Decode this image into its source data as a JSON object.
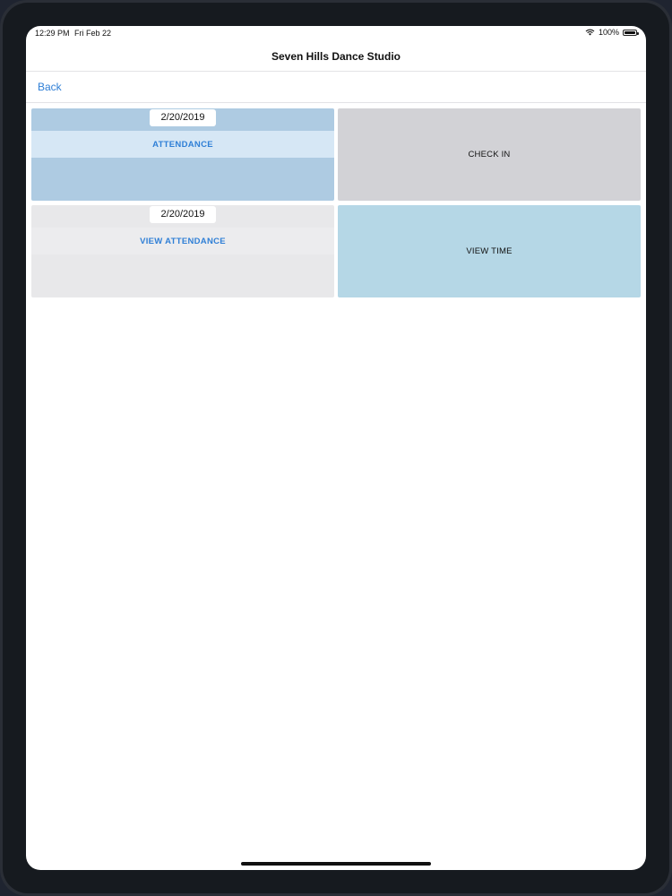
{
  "status_bar": {
    "time": "12:29 PM",
    "date": "Fri Feb 22",
    "battery_text": "100%",
    "battery_level": 1.0,
    "wifi_icon": "wifi-icon"
  },
  "nav": {
    "title": "Seven Hills Dance Studio",
    "back_label": "Back"
  },
  "tiles": {
    "attendance": {
      "date": "2/20/2019",
      "label": "ATTENDANCE"
    },
    "check_in": {
      "label": "CHECK IN"
    },
    "view_attendance": {
      "date": "2/20/2019",
      "label": "VIEW ATTENDANCE"
    },
    "view_time": {
      "label": "VIEW TIME"
    }
  },
  "colors": {
    "accent": "#2f7fd6",
    "attendance_tile": "#aecbe2",
    "check_in_tile": "#d2d2d6",
    "view_attendance_tile": "#e8e8ea",
    "view_time_tile": "#b5d7e6"
  }
}
